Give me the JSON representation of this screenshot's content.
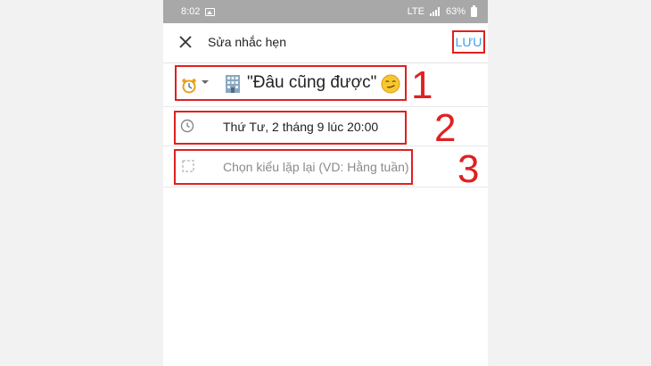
{
  "status_bar": {
    "time": "8:02",
    "network": "LTE",
    "battery": "63%"
  },
  "header": {
    "title": "Sửa nhắc hẹn",
    "save_label": "LƯU",
    "close_icon": "close-icon"
  },
  "reminder": {
    "name": "\"Đâu cũng được\"",
    "date_time": "Thứ Tư, 2 tháng 9 lúc 20:00",
    "repeat_placeholder": "Chọn kiểu lặp lại (VD: Hằng tuần)"
  },
  "annotations": [
    "1",
    "2",
    "3"
  ],
  "colors": {
    "highlight": "#e02020",
    "accent": "#3b9ef0",
    "status_bar": "#a8a8a8"
  },
  "icons": [
    "alarm-clock-icon",
    "building-icon",
    "smirk-emoji-icon",
    "clock-icon",
    "repeat-icon"
  ]
}
